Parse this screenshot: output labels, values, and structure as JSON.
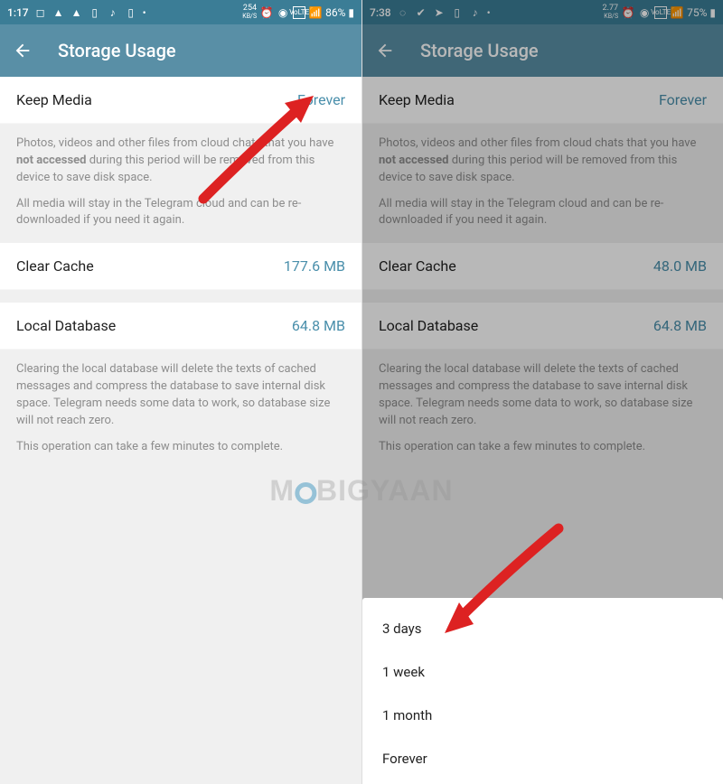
{
  "left": {
    "status": {
      "time": "1:17",
      "speed": "254",
      "speed_unit": "KB/S",
      "battery": "86%"
    },
    "header": {
      "title": "Storage Usage"
    },
    "keep_media": {
      "label": "Keep Media",
      "value": "Forever"
    },
    "media_info_1_pre": "Photos, videos and other files from cloud chats that you have ",
    "media_info_1_bold": "not accessed",
    "media_info_1_post": " during this period will be removed from this device to save disk space.",
    "media_info_2": "All media will stay in the Telegram cloud and can be re-downloaded if you need it again.",
    "clear_cache": {
      "label": "Clear Cache",
      "value": "177.6 MB"
    },
    "local_db": {
      "label": "Local Database",
      "value": "64.8 MB"
    },
    "db_info_1": "Clearing the local database will delete the texts of cached messages and compress the database to save internal disk space. Telegram needs some data to work, so database size will not reach zero.",
    "db_info_2": "This operation can take a few minutes to complete."
  },
  "right": {
    "status": {
      "time": "7:38",
      "speed": "2.77",
      "speed_unit": "KB/S",
      "battery": "75%"
    },
    "header": {
      "title": "Storage Usage"
    },
    "keep_media": {
      "label": "Keep Media",
      "value": "Forever"
    },
    "media_info_1_pre": "Photos, videos and other files from cloud chats that you have ",
    "media_info_1_bold": "not accessed",
    "media_info_1_post": " during this period will be removed from this device to save disk space.",
    "media_info_2": "All media will stay in the Telegram cloud and can be re-downloaded if you need it again.",
    "clear_cache": {
      "label": "Clear Cache",
      "value": "48.0 MB"
    },
    "local_db": {
      "label": "Local Database",
      "value": "64.8 MB"
    },
    "db_info_1": "Clearing the local database will delete the texts of cached messages and compress the database to save internal disk space. Telegram needs some data to work, so database size will not reach zero.",
    "db_info_2": "This operation can take a few minutes to complete.",
    "sheet": {
      "opt1": "3 days",
      "opt2": "1 week",
      "opt3": "1 month",
      "opt4": "Forever"
    }
  },
  "watermark": {
    "pre": "M",
    "post": "BIGYAAN"
  }
}
